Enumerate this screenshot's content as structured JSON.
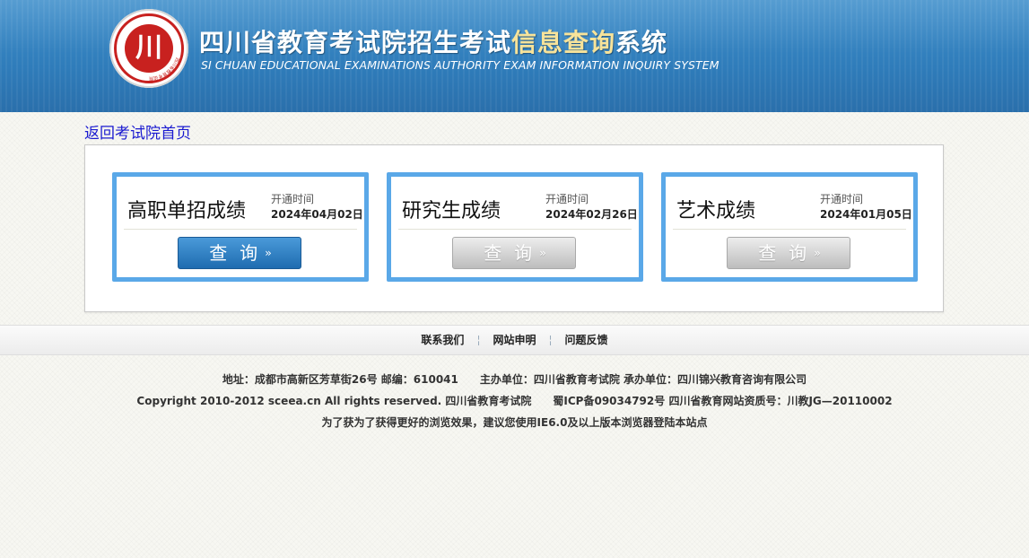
{
  "header": {
    "logo_glyph": "川",
    "logo_ring_text": "四川省教育考试院",
    "title_cn_main": "四川省教育考试院招生考试",
    "title_cn_highlight": "信息查询",
    "title_cn_tail": "系统",
    "title_en": "SI CHUAN EDUCATIONAL EXAMINATIONS AUTHORITY EXAM INFORMATION INQUIRY SYSTEM"
  },
  "nav": {
    "back_link": "返回考试院首页"
  },
  "cards": [
    {
      "title": "高职单招成绩",
      "open_label": "开通时间",
      "open_date": "2024年04月02日",
      "button": "查询",
      "arrow": "››",
      "state": "active"
    },
    {
      "title": "研究生成绩",
      "open_label": "开通时间",
      "open_date": "2024年02月26日",
      "button": "查询",
      "arrow": "››",
      "state": "inactive"
    },
    {
      "title": "艺术成绩",
      "open_label": "开通时间",
      "open_date": "2024年01月05日",
      "button": "查询",
      "arrow": "››",
      "state": "inactive"
    }
  ],
  "footer": {
    "links": [
      "联系我们",
      "网站申明",
      "问题反馈"
    ],
    "separator": "¦",
    "line1": "地址：成都市高新区芳草街26号 邮编：610041　　主办单位：四川省教育考试院 承办单位：四川锦兴教育咨询有限公司",
    "line2": "Copyright 2010-2012 sceea.cn All rights reserved. 四川省教育考试院　　蜀ICP备09034792号 四川省教育网站资质号：川教JG—20110002",
    "line3": "为了获为了获得更好的浏览效果，建议您使用IE6.0及以上版本浏览器登陆本站点"
  },
  "colors": {
    "header_blue": "#2f7cba",
    "title_highlight": "#f7e39a",
    "logo_red": "#c8211f",
    "card_border": "#5aa8e8",
    "button_active": "#1f6cb0",
    "link": "#1a1ad0"
  }
}
